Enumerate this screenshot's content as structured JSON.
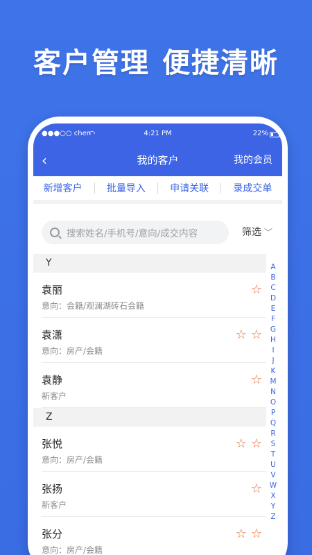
{
  "hero": {
    "left": "客户管理",
    "right": "便捷清晰"
  },
  "status": {
    "carrier": "●●●○○ chen",
    "time": "4:21 PM",
    "battery": "22%"
  },
  "nav": {
    "back": "‹",
    "title": "我的客户",
    "right": "我的会员"
  },
  "actions": [
    "新增客户",
    "批量导入",
    "申请关联",
    "录成交单"
  ],
  "search": {
    "placeholder": "搜索姓名/手机号/意向/成交内容",
    "filter": "筛选"
  },
  "groups": [
    {
      "letter": "Y",
      "items": [
        {
          "name": "袁丽",
          "sub": "意向：会籍/观澜湖砖石会籍",
          "stars": 1
        },
        {
          "name": "袁潇",
          "sub": "意向：房产/会籍",
          "stars": 2
        },
        {
          "name": "袁静",
          "sub": "新客户",
          "stars": 1
        }
      ]
    },
    {
      "letter": "Z",
      "items": [
        {
          "name": "张悦",
          "sub": "意向：房产/会籍",
          "stars": 2
        },
        {
          "name": "张扬",
          "sub": "新客户",
          "stars": 1
        },
        {
          "name": "张分",
          "sub": "意向：房产/会籍",
          "stars": 2
        }
      ]
    }
  ],
  "index_letters": [
    "A",
    "B",
    "C",
    "D",
    "E",
    "F",
    "G",
    "H",
    "I",
    "J",
    "K",
    "M",
    "N",
    "O",
    "P",
    "Q",
    "R",
    "S",
    "T",
    "U",
    "V",
    "W",
    "X",
    "Y",
    "Z"
  ],
  "colors": {
    "accent": "#3c64e4",
    "star": "#e56d36",
    "background": "#3f74e9"
  }
}
